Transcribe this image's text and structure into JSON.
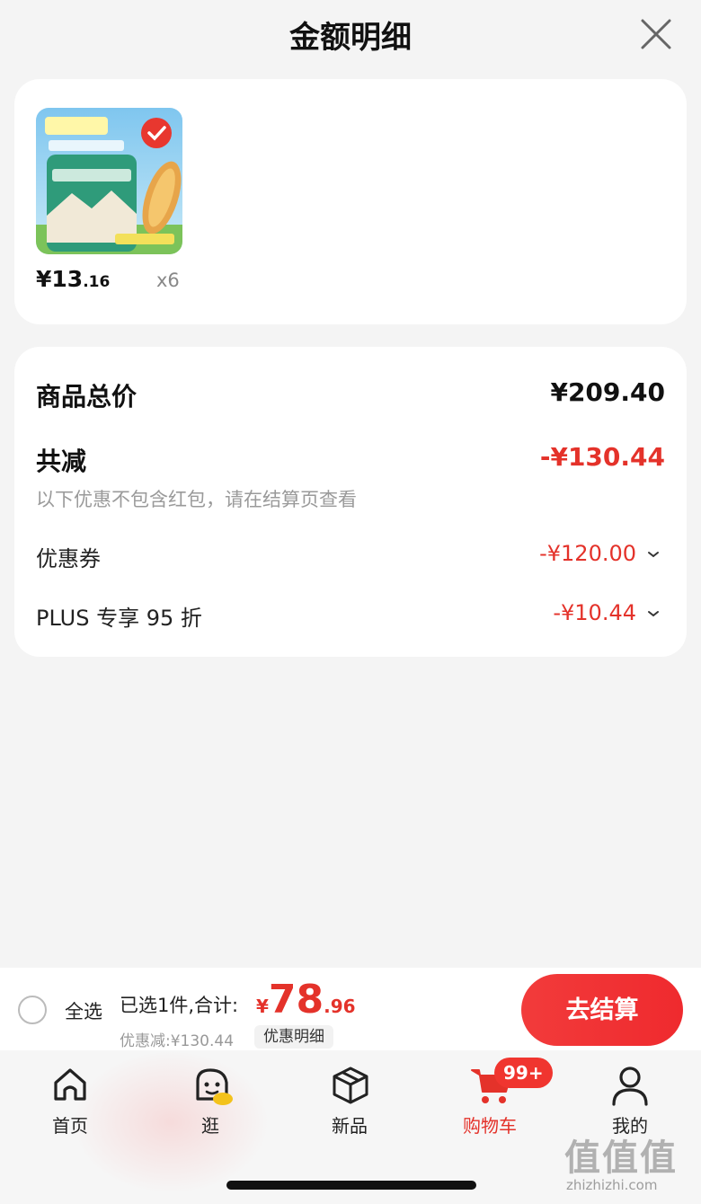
{
  "header": {
    "title": "金额明细",
    "close_icon": "close-icon"
  },
  "product": {
    "image_icon": "corn-snack-package-image",
    "price_symbol": "¥",
    "price_int": "13",
    "price_dec": ".16",
    "quantity": "x6"
  },
  "detail": {
    "total_label": "商品总价",
    "total_amount": "¥209.40",
    "reduce_label": "共减",
    "reduce_amount": "-¥130.44",
    "note": "以下优惠不包含红包，请在结算页查看",
    "coupon_label": "优惠券",
    "coupon_amount": "-¥120.00",
    "plus_label": "PLUS 专享 95 折",
    "plus_amount": "-¥10.44"
  },
  "checkout": {
    "select_all": "全选",
    "selected_summary": "已选1件,合计:",
    "total_yen": "¥",
    "total_int": "78",
    "total_dec": ".96",
    "discount_line": "优惠减:¥130.44",
    "discount_detail": "优惠明细",
    "checkout_button": "去结算"
  },
  "tabs": [
    {
      "label": "首页",
      "icon": "home-icon"
    },
    {
      "label": "逛",
      "icon": "stroll-icon"
    },
    {
      "label": "新品",
      "icon": "box-icon"
    },
    {
      "label": "购物车",
      "icon": "cart-icon",
      "badge": "99+",
      "active": true
    },
    {
      "label": "我的",
      "icon": "user-icon"
    }
  ],
  "watermark": {
    "text": "值值值",
    "url": "zhizhizhi.com"
  },
  "colors": {
    "accent": "#e4322a",
    "background": "#f4f4f4",
    "card": "#ffffff"
  }
}
